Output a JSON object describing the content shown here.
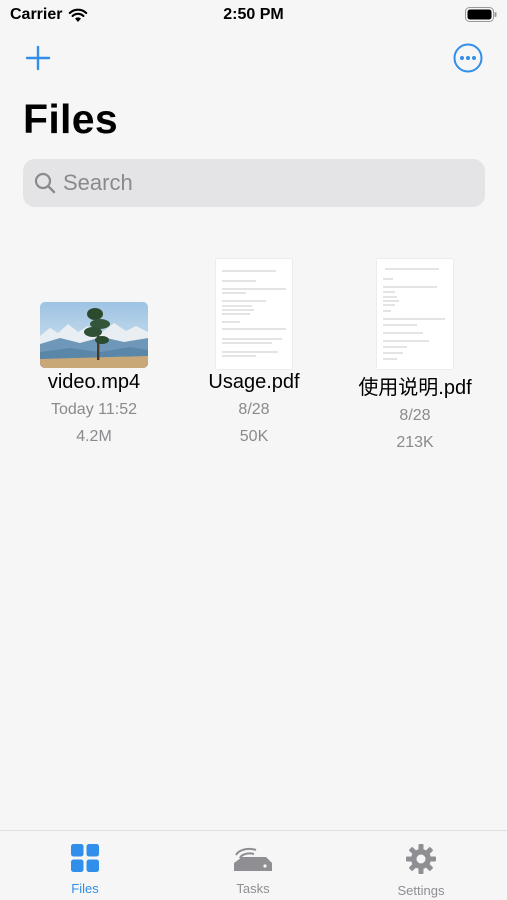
{
  "status_bar": {
    "carrier": "Carrier",
    "time": "2:50 PM"
  },
  "toolbar": {
    "add_icon": "plus-icon",
    "more_icon": "ellipsis-circle-icon"
  },
  "page": {
    "title": "Files"
  },
  "search": {
    "placeholder": "Search",
    "value": ""
  },
  "files": [
    {
      "name": "video.mp4",
      "date": "Today 11:52",
      "size": "4.2M",
      "thumb": "video-thumbnail"
    },
    {
      "name": "Usage.pdf",
      "date": "8/28",
      "size": "50K",
      "thumb": "pdf-thumbnail"
    },
    {
      "name": "使用说明.pdf",
      "date": "8/28",
      "size": "213K",
      "thumb": "pdf-thumbnail"
    }
  ],
  "tabs": [
    {
      "label": "Files",
      "icon": "grid-icon",
      "active": true
    },
    {
      "label": "Tasks",
      "icon": "drive-icon",
      "active": false
    },
    {
      "label": "Settings",
      "icon": "gear-icon",
      "active": false
    }
  ],
  "colors": {
    "accent": "#2f8fea",
    "inactive": "#8e8e93",
    "background": "#f6f6f6",
    "search_bg": "#e4e4e6"
  }
}
